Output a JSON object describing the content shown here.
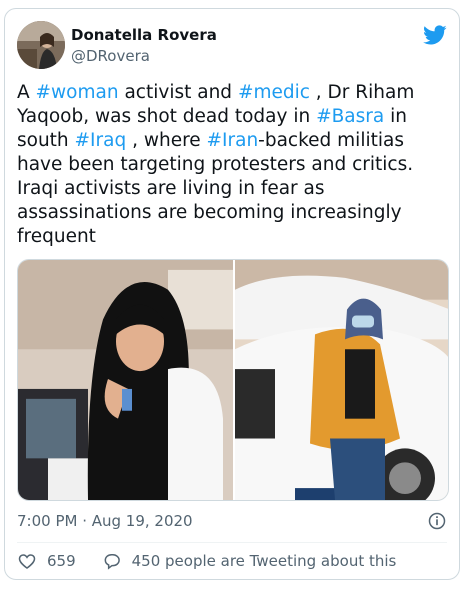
{
  "author": {
    "name": "Donatella Rovera",
    "handle": "@DRovera"
  },
  "icons": {
    "avatar": "profile-photo",
    "brand": "twitter-bird-icon",
    "info": "info-icon",
    "like": "heart-icon",
    "reply": "speech-bubble-icon"
  },
  "colors": {
    "accent": "#1d9bf0",
    "text": "#0f1419",
    "muted": "#536471",
    "border": "#cfd9de"
  },
  "tweet": {
    "segments": [
      {
        "t": "A ",
        "tag": false
      },
      {
        "t": "#woman",
        "tag": true
      },
      {
        "t": " activist and ",
        "tag": false
      },
      {
        "t": "#medic",
        "tag": true
      },
      {
        "t": " , Dr Riham Yaqoob, was shot dead today in ",
        "tag": false
      },
      {
        "t": "#Basra",
        "tag": true
      },
      {
        "t": " in south ",
        "tag": false
      },
      {
        "t": "#Iraq",
        "tag": true
      },
      {
        "t": " , where ",
        "tag": false
      },
      {
        "t": "#Iran",
        "tag": true
      },
      {
        "t": "-backed militias have been targeting protesters and critics. Iraqi activists are living in fear as assassinations are becoming increasingly frequent",
        "tag": false
      }
    ]
  },
  "media": [
    {
      "description": "selfie-woman-black-hijab"
    },
    {
      "description": "woman-orange-jacket-mask-by-white-car"
    }
  ],
  "timestamp": "7:00 PM · Aug 19, 2020",
  "likes": "659",
  "conversation": "450 people are Tweeting about this"
}
